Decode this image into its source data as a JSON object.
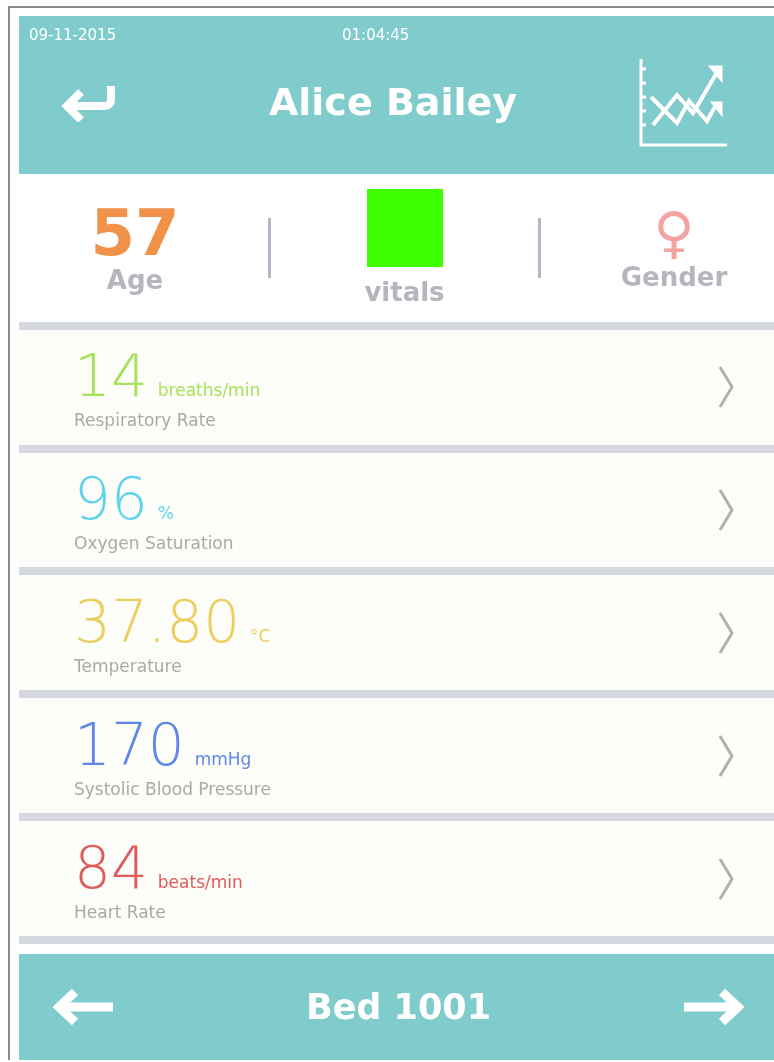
{
  "status_bar": {
    "date": "09-11-2015",
    "time": "01:04:45"
  },
  "header": {
    "title": "Alice Bailey"
  },
  "summary": {
    "age": {
      "value": "57",
      "label": "Age"
    },
    "vitals": {
      "label": "vitals",
      "color": "#40ff00"
    },
    "gender": {
      "symbol": "♀",
      "label": "Gender"
    }
  },
  "vitals": [
    {
      "value": "14",
      "unit": "breaths/min",
      "label": "Respiratory Rate",
      "color": "#a6e35a"
    },
    {
      "value": "96",
      "unit": "%",
      "label": "Oxygen Saturation",
      "color": "#5fd3ee"
    },
    {
      "value": "37.80",
      "unit": "°C",
      "label": "Temperature",
      "color": "#ecce5c"
    },
    {
      "value": "170",
      "unit": "mmHg",
      "label": "Systolic Blood Pressure",
      "color": "#5f86ea"
    },
    {
      "value": "84",
      "unit": "beats/min",
      "label": "Heart Rate",
      "color": "#e05a5a"
    }
  ],
  "footer": {
    "title": "Bed 1001"
  }
}
